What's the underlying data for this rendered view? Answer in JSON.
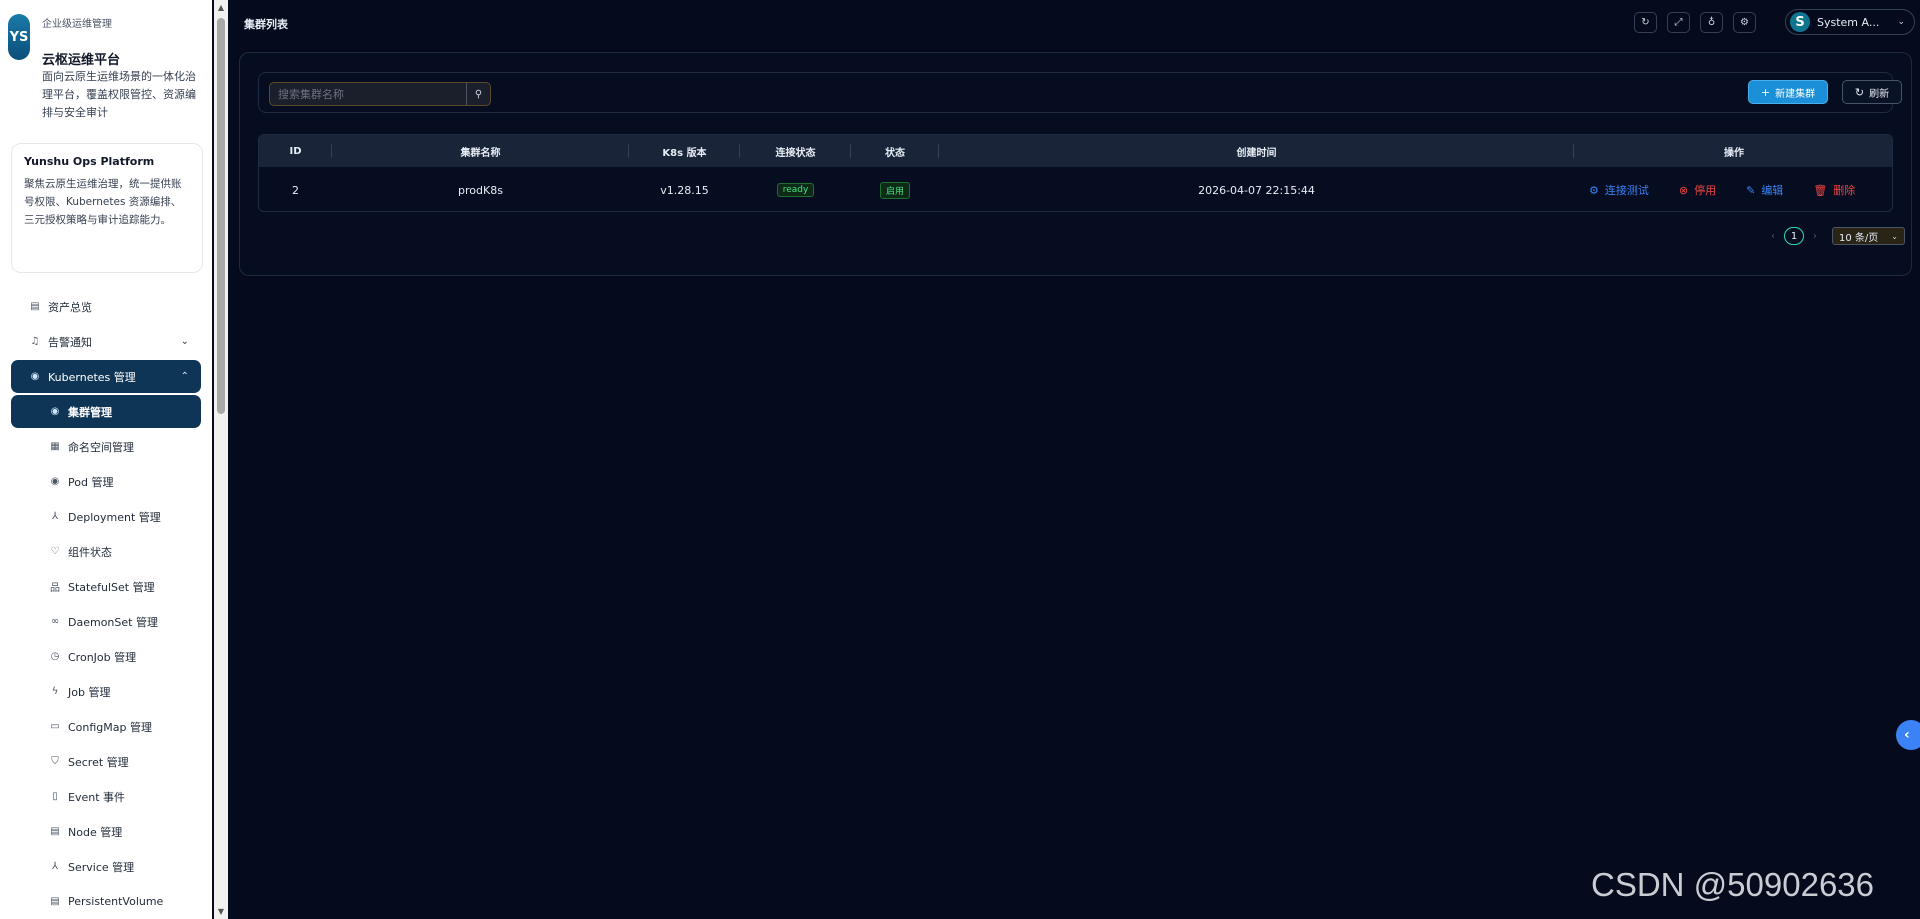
{
  "brand": {
    "logo": "YS",
    "subtitle": "企业级运维管理",
    "title": "云枢运维平台",
    "description": "面向云原生运维场景的一体化治理平台，覆盖权限管控、资源编排与安全审计"
  },
  "intro": {
    "heading": "Yunshu Ops Platform",
    "text": "聚焦云原生运维治理，统一提供账号权限、Kubernetes 资源编排、三元授权策略与审计追踪能力。"
  },
  "nav": {
    "assets": "资产总览",
    "alerts": "告警通知",
    "k8s": "Kubernetes 管理",
    "cluster": "集群管理",
    "namespace": "命名空间管理",
    "pod": "Pod 管理",
    "deployment": "Deployment 管理",
    "component": "组件状态",
    "statefulset": "StatefulSet 管理",
    "daemonset": "DaemonSet 管理",
    "cronjob": "CronJob 管理",
    "job": "Job 管理",
    "configmap": "ConfigMap 管理",
    "secret": "Secret 管理",
    "event": "Event 事件",
    "node": "Node 管理",
    "service": "Service 管理",
    "pv": "PersistentVolume"
  },
  "header": {
    "title": "集群列表",
    "user_avatar": "S",
    "user_name": "System A..."
  },
  "toolbar": {
    "search_placeholder": "搜索集群名称",
    "new_label": "新建集群",
    "refresh_label": "刷新"
  },
  "table": {
    "columns": [
      "ID",
      "集群名称",
      "K8s 版本",
      "连接状态",
      "状态",
      "创建时间",
      "操作"
    ],
    "rows": [
      {
        "id": "2",
        "name": "prodK8s",
        "version": "v1.28.15",
        "conn": "ready",
        "status": "启用",
        "created": "2026-04-07 22:15:44",
        "ops": [
          "连接测试",
          "停用",
          "编辑",
          "删除"
        ]
      }
    ]
  },
  "pagination": {
    "current": "1",
    "page_size": "10 条/页"
  },
  "watermark": "CSDN @50902636",
  "colors": {
    "accent": "#1b8fd8",
    "active_nav": "#0f3556",
    "danger": "#ef4444",
    "link": "#3b82f6",
    "success": "#4ade80"
  }
}
